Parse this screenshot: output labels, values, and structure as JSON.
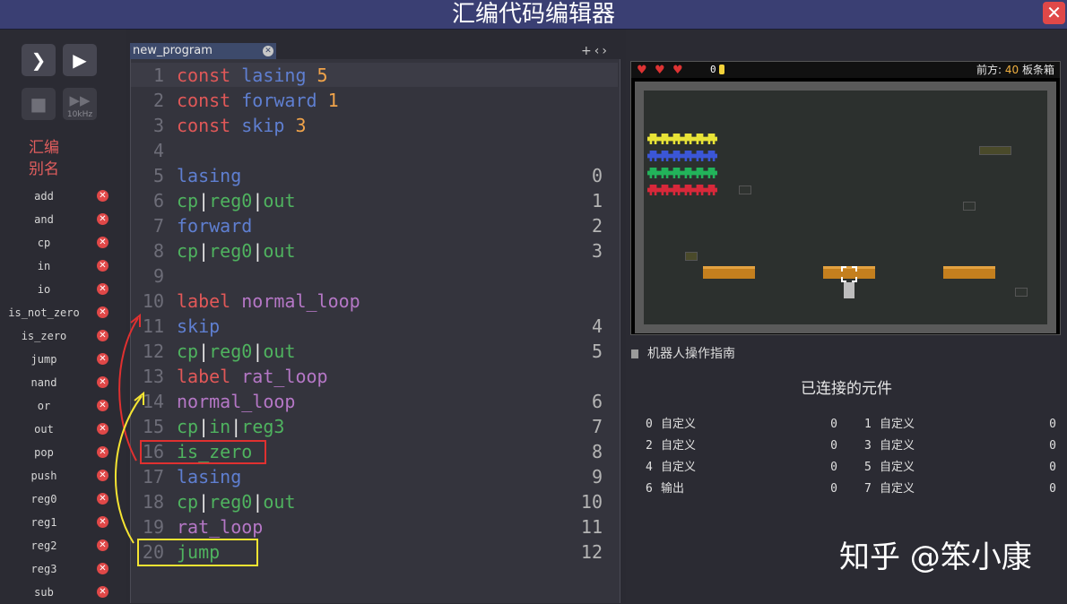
{
  "window": {
    "title": "汇编代码编辑器",
    "close_label": "✕"
  },
  "controls": {
    "run": "❯",
    "step": "▶",
    "stop": "■",
    "fast": "▶▶",
    "speed": "10kHz"
  },
  "aliases": {
    "title": "汇编\n别名",
    "items": [
      "add",
      "and",
      "cp",
      "in",
      "io",
      "is_not_zero",
      "is_zero",
      "jump",
      "nand",
      "or",
      "out",
      "pop",
      "push",
      "reg0",
      "reg1",
      "reg2",
      "reg3",
      "sub"
    ],
    "delete_label": "✕"
  },
  "editor": {
    "tab_name": "new_program",
    "tab_close": "✕",
    "tab_nav": "+‹›",
    "lines": [
      {
        "n": "1",
        "addr": "",
        "tokens": [
          {
            "t": "const ",
            "c": "k-const"
          },
          {
            "t": "lasing ",
            "c": "k-sym"
          },
          {
            "t": "5",
            "c": "k-num"
          }
        ]
      },
      {
        "n": "2",
        "addr": "",
        "tokens": [
          {
            "t": "const ",
            "c": "k-const"
          },
          {
            "t": "forward ",
            "c": "k-sym"
          },
          {
            "t": "1",
            "c": "k-num"
          }
        ]
      },
      {
        "n": "3",
        "addr": "",
        "tokens": [
          {
            "t": "const ",
            "c": "k-const"
          },
          {
            "t": "skip ",
            "c": "k-sym"
          },
          {
            "t": "3",
            "c": "k-num"
          }
        ]
      },
      {
        "n": "4",
        "addr": "",
        "tokens": []
      },
      {
        "n": "5",
        "addr": "0",
        "tokens": [
          {
            "t": "lasing",
            "c": "k-sym"
          }
        ]
      },
      {
        "n": "6",
        "addr": "1",
        "tokens": [
          {
            "t": "cp",
            "c": "k-op"
          },
          {
            "t": "|",
            "c": "k-pipe"
          },
          {
            "t": "reg0",
            "c": "k-op"
          },
          {
            "t": "|",
            "c": "k-pipe"
          },
          {
            "t": "out",
            "c": "k-op"
          }
        ]
      },
      {
        "n": "7",
        "addr": "2",
        "tokens": [
          {
            "t": "forward",
            "c": "k-sym"
          }
        ]
      },
      {
        "n": "8",
        "addr": "3",
        "tokens": [
          {
            "t": "cp",
            "c": "k-op"
          },
          {
            "t": "|",
            "c": "k-pipe"
          },
          {
            "t": "reg0",
            "c": "k-op"
          },
          {
            "t": "|",
            "c": "k-pipe"
          },
          {
            "t": "out",
            "c": "k-op"
          }
        ]
      },
      {
        "n": "9",
        "addr": "",
        "tokens": []
      },
      {
        "n": "10",
        "addr": "",
        "tokens": [
          {
            "t": "label ",
            "c": "k-label"
          },
          {
            "t": "normal_loop",
            "c": "k-lname"
          }
        ]
      },
      {
        "n": "11",
        "addr": "4",
        "tokens": [
          {
            "t": "skip",
            "c": "k-sym"
          }
        ]
      },
      {
        "n": "12",
        "addr": "5",
        "tokens": [
          {
            "t": "cp",
            "c": "k-op"
          },
          {
            "t": "|",
            "c": "k-pipe"
          },
          {
            "t": "reg0",
            "c": "k-op"
          },
          {
            "t": "|",
            "c": "k-pipe"
          },
          {
            "t": "out",
            "c": "k-op"
          }
        ]
      },
      {
        "n": "13",
        "addr": "",
        "tokens": [
          {
            "t": "label ",
            "c": "k-label"
          },
          {
            "t": "rat_loop",
            "c": "k-lname"
          }
        ]
      },
      {
        "n": "14",
        "addr": "6",
        "tokens": [
          {
            "t": "normal_loop",
            "c": "k-cmt"
          }
        ]
      },
      {
        "n": "15",
        "addr": "7",
        "tokens": [
          {
            "t": "cp",
            "c": "k-op"
          },
          {
            "t": "|",
            "c": "k-pipe"
          },
          {
            "t": "in",
            "c": "k-op"
          },
          {
            "t": "|",
            "c": "k-pipe"
          },
          {
            "t": "reg3",
            "c": "k-op"
          }
        ]
      },
      {
        "n": "16",
        "addr": "8",
        "tokens": [
          {
            "t": "is_zero",
            "c": "k-op"
          }
        ]
      },
      {
        "n": "17",
        "addr": "9",
        "tokens": [
          {
            "t": "lasing",
            "c": "k-sym"
          }
        ]
      },
      {
        "n": "18",
        "addr": "10",
        "tokens": [
          {
            "t": "cp",
            "c": "k-op"
          },
          {
            "t": "|",
            "c": "k-pipe"
          },
          {
            "t": "reg0",
            "c": "k-op"
          },
          {
            "t": "|",
            "c": "k-pipe"
          },
          {
            "t": "out",
            "c": "k-op"
          }
        ]
      },
      {
        "n": "19",
        "addr": "11",
        "tokens": [
          {
            "t": "rat_loop",
            "c": "k-cmt"
          }
        ]
      },
      {
        "n": "20",
        "addr": "12",
        "tokens": [
          {
            "t": "jump",
            "c": "k-op"
          }
        ]
      }
    ]
  },
  "game": {
    "hearts": 3,
    "coin_count": "0",
    "ahead_label": "前方: ",
    "ahead_value": "40",
    "ahead_item": " 板条箱"
  },
  "guide_label": "机器人操作指南",
  "components": {
    "title": "已连接的元件",
    "items": [
      {
        "i": "0",
        "name": "自定义",
        "v": "0"
      },
      {
        "i": "1",
        "name": "自定义",
        "v": "0"
      },
      {
        "i": "2",
        "name": "自定义",
        "v": "0"
      },
      {
        "i": "3",
        "name": "自定义",
        "v": "0"
      },
      {
        "i": "4",
        "name": "自定义",
        "v": "0"
      },
      {
        "i": "5",
        "name": "自定义",
        "v": "0"
      },
      {
        "i": "6",
        "name": "输出",
        "v": "0"
      },
      {
        "i": "7",
        "name": "自定义",
        "v": "0"
      }
    ]
  },
  "watermark": "知乎 @笨小康",
  "colors": {
    "title_bar": "#3a3f73",
    "close": "#e04848",
    "annotation_red": "#e03030",
    "annotation_yellow": "#f5e432"
  }
}
